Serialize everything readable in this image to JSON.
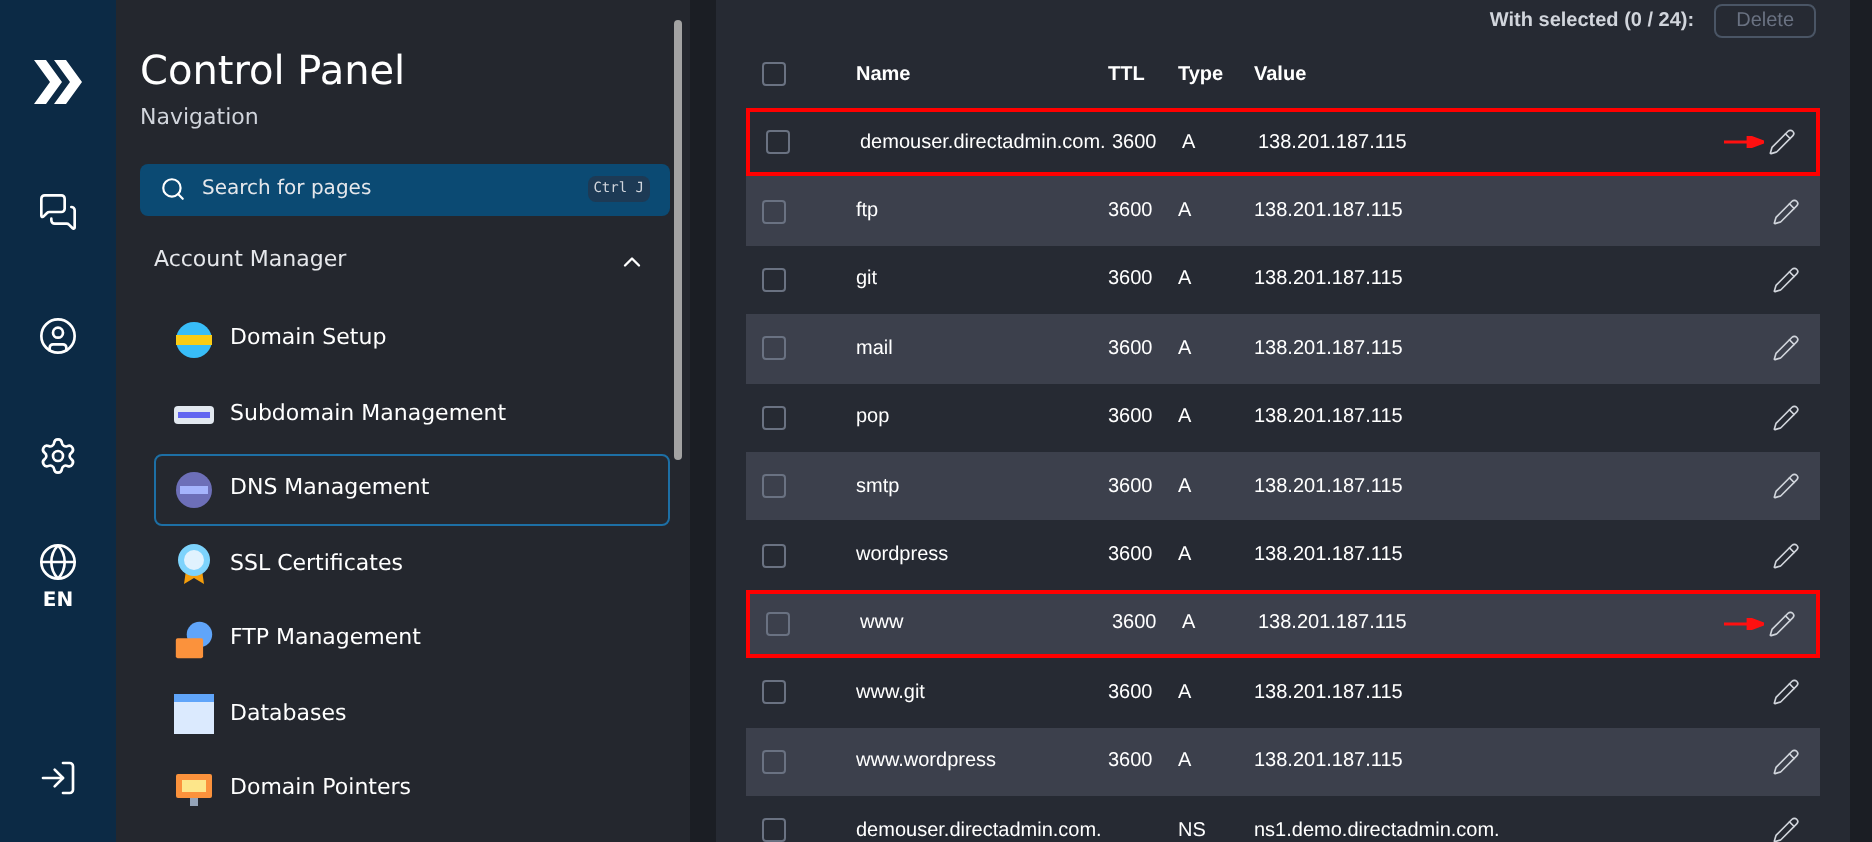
{
  "rail": {
    "language": "EN"
  },
  "sidebar": {
    "title": "Control Panel",
    "subtitle": "Navigation",
    "search": {
      "placeholder": "Search for pages",
      "shortcut": "Ctrl J"
    },
    "section": {
      "label": "Account Manager",
      "expanded": true
    },
    "items": [
      {
        "label": "Domain Setup",
        "kind": "globe",
        "selected": false
      },
      {
        "label": "Subdomain Management",
        "kind": "bar",
        "selected": false
      },
      {
        "label": "DNS Management",
        "kind": "dns",
        "selected": true
      },
      {
        "label": "SSL Certificates",
        "kind": "ssl",
        "selected": false
      },
      {
        "label": "FTP Management",
        "kind": "ftp",
        "selected": false
      },
      {
        "label": "Databases",
        "kind": "sql",
        "selected": false
      },
      {
        "label": "Domain Pointers",
        "kind": "pointer",
        "selected": false
      }
    ]
  },
  "bulk": {
    "label": "With selected (0 / 24):",
    "button": "Delete"
  },
  "table": {
    "select_all_checked": false,
    "columns": [
      "Name",
      "TTL",
      "Type",
      "Value"
    ],
    "rows": [
      {
        "name": "demouser.directadmin.com.",
        "ttl": "3600",
        "type": "A",
        "value": "138.201.187.115",
        "checked": false,
        "highlighted": true
      },
      {
        "name": "ftp",
        "ttl": "3600",
        "type": "A",
        "value": "138.201.187.115",
        "checked": false,
        "highlighted": false
      },
      {
        "name": "git",
        "ttl": "3600",
        "type": "A",
        "value": "138.201.187.115",
        "checked": false,
        "highlighted": false
      },
      {
        "name": "mail",
        "ttl": "3600",
        "type": "A",
        "value": "138.201.187.115",
        "checked": false,
        "highlighted": false
      },
      {
        "name": "pop",
        "ttl": "3600",
        "type": "A",
        "value": "138.201.187.115",
        "checked": false,
        "highlighted": false
      },
      {
        "name": "smtp",
        "ttl": "3600",
        "type": "A",
        "value": "138.201.187.115",
        "checked": false,
        "highlighted": false
      },
      {
        "name": "wordpress",
        "ttl": "3600",
        "type": "A",
        "value": "138.201.187.115",
        "checked": false,
        "highlighted": false
      },
      {
        "name": "www",
        "ttl": "3600",
        "type": "A",
        "value": "138.201.187.115",
        "checked": false,
        "highlighted": true
      },
      {
        "name": "www.git",
        "ttl": "3600",
        "type": "A",
        "value": "138.201.187.115",
        "checked": false,
        "highlighted": false
      },
      {
        "name": "www.wordpress",
        "ttl": "3600",
        "type": "A",
        "value": "138.201.187.115",
        "checked": false,
        "highlighted": false
      },
      {
        "name": "demouser.directadmin.com.",
        "type": "NS",
        "value": "ns1.demo.directadmin.com.",
        "checked": false,
        "highlighted": false
      }
    ]
  }
}
